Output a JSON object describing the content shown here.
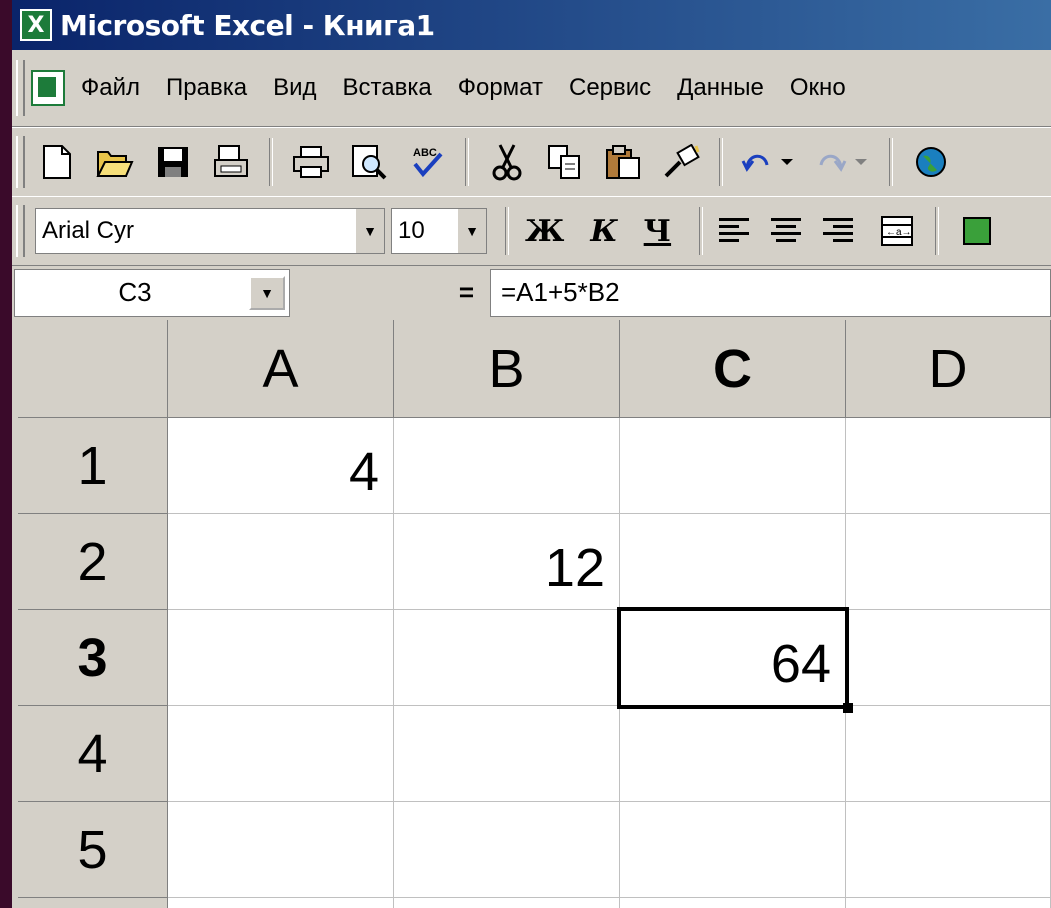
{
  "window": {
    "title": "Microsoft Excel - Книга1",
    "app_icon": "excel-icon"
  },
  "menu": {
    "items": [
      "Файл",
      "Правка",
      "Вид",
      "Вставка",
      "Формат",
      "Сервис",
      "Данные",
      "Окно"
    ]
  },
  "toolbar_standard": {
    "buttons": [
      "new-icon",
      "open-icon",
      "save-icon",
      "mail-icon",
      "print-icon",
      "print-preview-icon",
      "spelling-icon",
      "cut-icon",
      "copy-icon",
      "paste-icon",
      "format-painter-icon",
      "undo-icon",
      "redo-icon",
      "web-icon"
    ]
  },
  "toolbar_format": {
    "font_name": "Arial Cyr",
    "font_size": "10",
    "bold_label": "Ж",
    "italic_label": "К",
    "underline_label": "Ч"
  },
  "formula_bar": {
    "name_box": "C3",
    "equals": "=",
    "formula": "=A1+5*B2"
  },
  "sheet": {
    "columns": [
      "A",
      "B",
      "C",
      "D"
    ],
    "rows": [
      "1",
      "2",
      "3",
      "4",
      "5"
    ],
    "active_cell": "C3",
    "active_column": "C",
    "active_row": "3",
    "cells": {
      "A1": "4",
      "B2": "12",
      "C3": "64"
    }
  }
}
